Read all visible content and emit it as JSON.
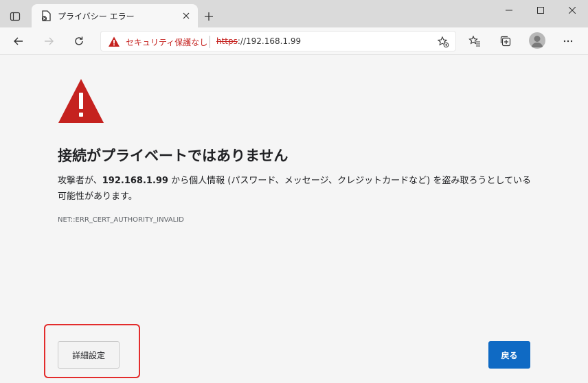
{
  "tab": {
    "title": "プライバシー エラー",
    "favicon": "error-page-icon"
  },
  "address_bar": {
    "security_label": "セキュリティ保護なし",
    "url_scheme": "https",
    "url_rest": "://192.168.1.99"
  },
  "toolbar_icons": [
    "back-icon",
    "forward-icon",
    "refresh-icon",
    "add-favorite-icon",
    "favorites-icon",
    "collections-icon",
    "profile-icon",
    "more-icon"
  ],
  "content": {
    "heading": "接続がプライベートではありません",
    "explanation_prefix": "攻撃者が、",
    "explanation_host": "192.168.1.99",
    "explanation_suffix": " から個人情報 (パスワード、メッセージ、クレジットカードなど) を盗み取ろうとしている可能性があります。",
    "error_code": "NET::ERR_CERT_AUTHORITY_INVALID"
  },
  "buttons": {
    "advanced": "詳細設定",
    "back": "戻る"
  },
  "colors": {
    "warning_red": "#c5221f",
    "primary_button": "#0f6ac4",
    "highlight_border": "#e32c2c"
  }
}
